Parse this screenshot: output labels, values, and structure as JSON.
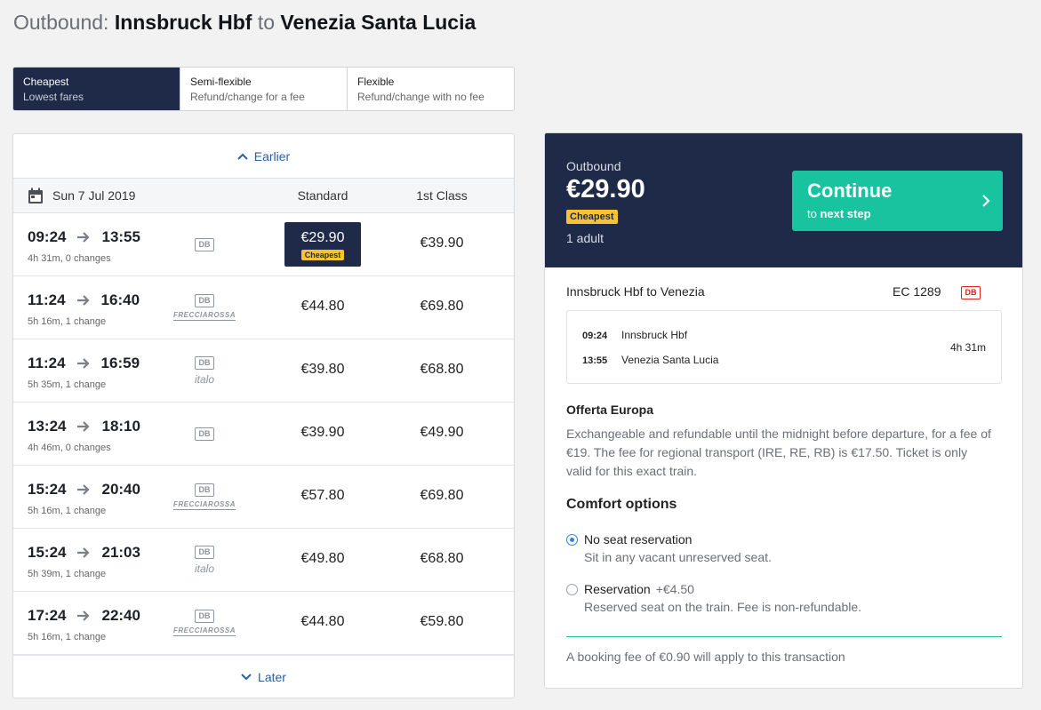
{
  "header": {
    "prefix": "Outbound:",
    "origin": "Innsbruck Hbf",
    "connector": "to",
    "destination": "Venezia Santa Lucia"
  },
  "fare_tabs": [
    {
      "title": "Cheapest",
      "subtitle": "Lowest fares",
      "active": true
    },
    {
      "title": "Semi-flexible",
      "subtitle": "Refund/change for a fee",
      "active": false
    },
    {
      "title": "Flexible",
      "subtitle": "Refund/change with no fee",
      "active": false
    }
  ],
  "results": {
    "earlier_label": "Earlier",
    "later_label": "Later",
    "date": "Sun 7 Jul 2019",
    "col_standard": "Standard",
    "col_first": "1st Class",
    "cheapest_badge": "Cheapest",
    "rows": [
      {
        "dep": "09:24",
        "arr": "13:55",
        "info": "4h 31m, 0 changes",
        "carriers": [
          "db"
        ],
        "standard": "€29.90",
        "first": "€39.90",
        "selected": true
      },
      {
        "dep": "11:24",
        "arr": "16:40",
        "info": "5h 16m, 1 change",
        "carriers": [
          "db",
          "frecciarossa"
        ],
        "standard": "€44.80",
        "first": "€69.80"
      },
      {
        "dep": "11:24",
        "arr": "16:59",
        "info": "5h 35m, 1 change",
        "carriers": [
          "db",
          "italo"
        ],
        "standard": "€39.80",
        "first": "€68.80"
      },
      {
        "dep": "13:24",
        "arr": "18:10",
        "info": "4h 46m, 0 changes",
        "carriers": [
          "db"
        ],
        "standard": "€39.90",
        "first": "€49.90"
      },
      {
        "dep": "15:24",
        "arr": "20:40",
        "info": "5h 16m, 1 change",
        "carriers": [
          "db",
          "frecciarossa"
        ],
        "standard": "€57.80",
        "first": "€69.80"
      },
      {
        "dep": "15:24",
        "arr": "21:03",
        "info": "5h 39m, 1 change",
        "carriers": [
          "db",
          "italo"
        ],
        "standard": "€49.80",
        "first": "€68.80"
      },
      {
        "dep": "17:24",
        "arr": "22:40",
        "info": "5h 16m, 1 change",
        "carriers": [
          "db",
          "frecciarossa"
        ],
        "standard": "€44.80",
        "first": "€59.80"
      }
    ]
  },
  "carrier_text": {
    "db": "DB",
    "frecciarossa": "FRECCIAROSSA",
    "italo": "italo"
  },
  "summary": {
    "label": "Outbound",
    "price": "€29.90",
    "badge": "Cheapest",
    "passengers": "1 adult",
    "continue_title": "Continue",
    "continue_sub_prefix": "to",
    "continue_sub_bold": "next step",
    "route": "Innsbruck Hbf to Venezia",
    "train_number": "EC 1289",
    "operator_logo": "DB",
    "leg": {
      "dep_time": "09:24",
      "dep_station": "Innsbruck Hbf",
      "arr_time": "13:55",
      "arr_station": "Venezia Santa Lucia",
      "duration": "4h 31m"
    },
    "offer_title": "Offerta Europa",
    "offer_desc": "Exchangeable and refundable until the midnight before departure, for a fee of €19. The fee for regional transport (IRE, RE, RB) is €17.50. Ticket is only valid for this exact train.",
    "comfort_title": "Comfort options",
    "options": [
      {
        "name": "No seat reservation",
        "fee": "",
        "desc": "Sit in any vacant unreserved seat.",
        "selected": true
      },
      {
        "name": "Reservation",
        "fee": "+€4.50",
        "desc": "Reserved seat on the train. Fee is non-refundable.",
        "selected": false
      }
    ],
    "booking_fee": "A booking fee of €0.90 will apply to this transaction"
  },
  "colors": {
    "navy": "#1e2a47",
    "accent": "#19c3a0",
    "badge": "#f8c233",
    "link": "#2a5fa8"
  }
}
